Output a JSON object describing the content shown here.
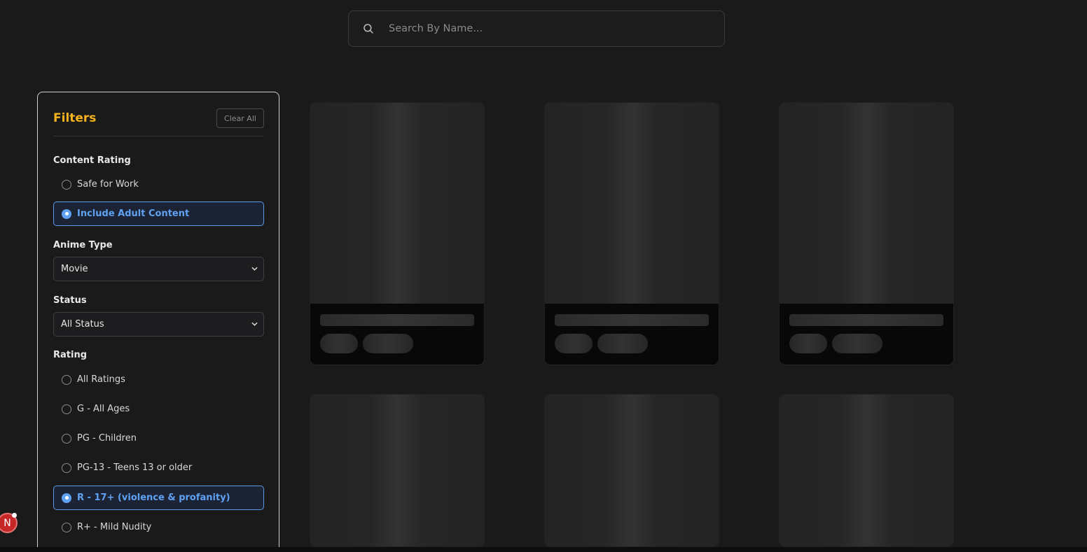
{
  "search": {
    "placeholder": "Search By Name..."
  },
  "filters": {
    "title": "Filters",
    "clear_label": "Clear All",
    "content_rating": {
      "label": "Content Rating",
      "options": [
        {
          "label": "Safe for Work",
          "selected": false
        },
        {
          "label": "Include Adult Content",
          "selected": true
        }
      ]
    },
    "anime_type": {
      "label": "Anime Type",
      "value": "Movie"
    },
    "status": {
      "label": "Status",
      "value": "All Status"
    },
    "rating": {
      "label": "Rating",
      "options": [
        {
          "label": "All Ratings",
          "selected": false
        },
        {
          "label": "G - All Ages",
          "selected": false
        },
        {
          "label": "PG - Children",
          "selected": false
        },
        {
          "label": "PG-13 - Teens 13 or older",
          "selected": false
        },
        {
          "label": "R - 17+ (violence & profanity)",
          "selected": true
        },
        {
          "label": "R+ - Mild Nudity",
          "selected": false
        }
      ]
    }
  },
  "badge": {
    "letter": "N"
  },
  "colors": {
    "accent": "#f5b21c",
    "selected": "#5fa1f2",
    "background": "#1a1a1a"
  },
  "icons": {
    "search": "search-icon",
    "chevron": "chevron-down-icon"
  }
}
